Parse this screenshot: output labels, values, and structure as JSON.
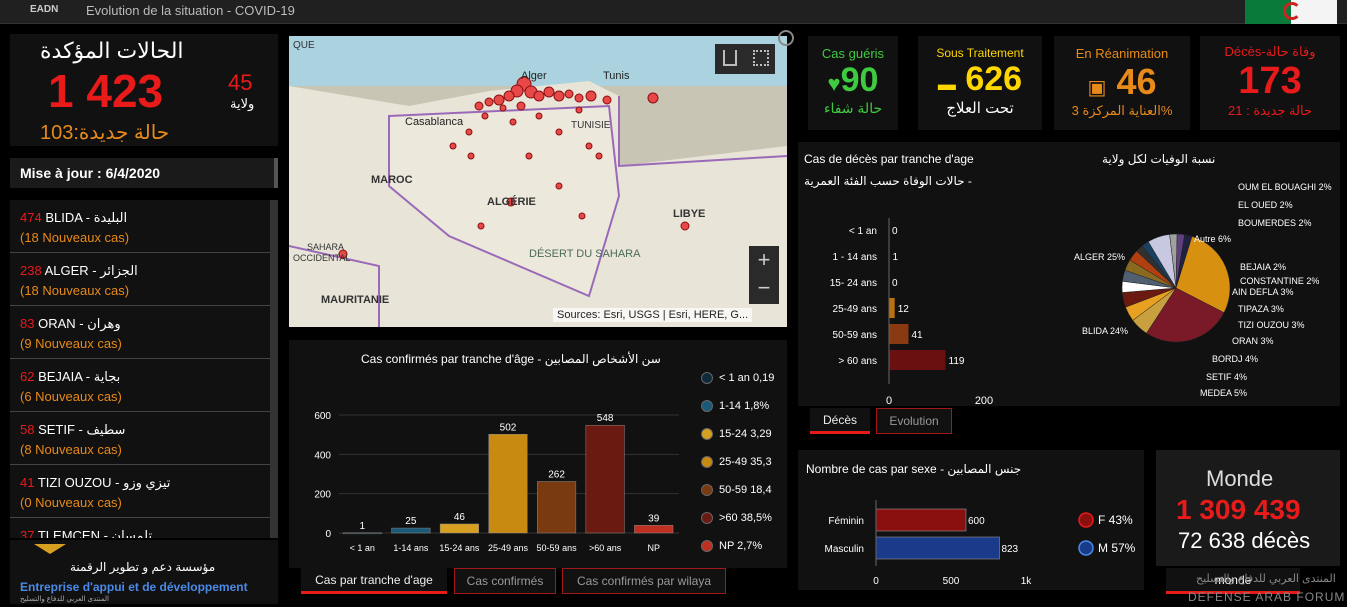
{
  "header": {
    "logo": "EADN",
    "title": "Evolution de la situation - COVID-19"
  },
  "confirmed": {
    "title_ar": "الحالات المؤكدة",
    "total": "1 423",
    "wilaya_count": "45",
    "wilaya_label": "ولاية",
    "new_cases": "حالة جديدة:103"
  },
  "update": {
    "label": "Mise à jour : 6/4/2020"
  },
  "wilaya_list": [
    {
      "count": "474",
      "name": " BLIDA - ",
      "ar": "البليدة",
      "new": "(18 Nouveaux cas)"
    },
    {
      "count": "238",
      "name": " ALGER - ",
      "ar": "الجزائر",
      "new": "(18 Nouveaux cas)"
    },
    {
      "count": "83",
      "name": " ORAN - ",
      "ar": "وهران",
      "new": "(9 Nouveaux cas)"
    },
    {
      "count": "62",
      "name": " BEJAIA - ",
      "ar": "بجاية",
      "new": "(6 Nouveaux cas)"
    },
    {
      "count": "58",
      "name": " SETIF - ",
      "ar": "سطيف",
      "new": "(8 Nouveaux cas)"
    },
    {
      "count": "41",
      "name": " TIZI OUZOU - ",
      "ar": "تيزي وزو",
      "new": "(0 Nouveaux cas)"
    },
    {
      "count": "37",
      "name": " TLEMCEN - ",
      "ar": "تلمسان",
      "new": ""
    }
  ],
  "footer_logo": {
    "ar": "مؤسسة دعم و تطوير الرقمنة",
    "fr": "Entreprise d'appui et de développement",
    "small": "المنتدى العربي للدفاع والتسليح"
  },
  "map": {
    "labels": [
      "Alger",
      "Tunis",
      "Casablanca",
      "TUNISIE",
      "MAROC",
      "ALGÉRIE",
      "LIBYE",
      "DÉSERT DU SAHARA",
      "SAHARA",
      "OCCIDENTAL",
      "MAURITANIE",
      "QUE"
    ],
    "attribution": "Sources: Esri, USGS | Esri, HERE, G..."
  },
  "stats": {
    "recovered": {
      "label": "Cas guéris",
      "value": "90",
      "ar": "حالة شفاء"
    },
    "treatment": {
      "label": "Sous Traitement",
      "value": "626",
      "ar": "تحت العلاج"
    },
    "icu": {
      "label": "En Réanimation",
      "value": "46",
      "ar": "العناية المركزة 3%"
    },
    "deaths": {
      "label": "Décès-وفاة حالة",
      "value": "173",
      "new": "حالة جديدة : 21"
    }
  },
  "age_chart": {
    "title": "Cas confirmés par tranche d'âge - سن الأشخاص المصابين",
    "legend": [
      "< 1 an 0,19",
      "1-14 1,8%",
      "15-24 3,29",
      "25-49 35,3",
      "50-59 18,4",
      ">60 38,5%",
      "NP 2,7%"
    ],
    "tabs": [
      "Cas par tranche d'age",
      "Cas confirmés",
      "Cas confirmés par wilaya"
    ]
  },
  "death_chart": {
    "title": "Cas de décès par tranche d'age",
    "subtitle": "حالات الوفاة حسب الفئة العمرية -",
    "tabs": [
      "Décès",
      "Evolution"
    ]
  },
  "pie_chart": {
    "title": "نسبة الوفيات لكل ولاية",
    "labels": [
      "OUM EL BOUAGHI 2%",
      "EL OUED 2%",
      "BOUMERDES 2%",
      "Autre 6%",
      "ALGER 25%",
      "BEJAIA 2%",
      "CONSTANTINE 2%",
      "AIN DEFLA 3%",
      "TIPAZA 3%",
      "TIZI OUZOU 3%",
      "ORAN 3%",
      "BLIDA 24%",
      "BORDJ 4%",
      "SETIF 4%",
      "MEDEA 5%"
    ]
  },
  "sex_chart": {
    "title": "Nombre de cas par sexe - جنس المصابين",
    "legend": [
      "F  43%",
      "M  57%"
    ]
  },
  "world": {
    "title": "Monde",
    "cases": "1 309 439",
    "deaths": "72 638 décès",
    "tab": "monde"
  },
  "watermark": {
    "ar": "المنتدى العربي للدفاع والتسليح",
    "en": "DEFENSE ARAB FORUM"
  },
  "colors": {
    "accent": "#e81a1a",
    "orange": "#e88a1a",
    "green": "#3fcb3f",
    "yellow": "#ffd600"
  },
  "chart_data": [
    {
      "type": "bar",
      "categories": [
        "< 1 an",
        "1-14 ans",
        "15-24 ans",
        "25-49 ans",
        "50-59 ans",
        ">60 ans",
        "NP"
      ],
      "values": [
        1,
        25,
        46,
        502,
        262,
        548,
        39
      ],
      "ylim": [
        0,
        600
      ],
      "yticks": [
        0,
        200,
        400,
        600
      ],
      "colors": [
        "#102a3a",
        "#1a5a78",
        "#d8a020",
        "#c88a10",
        "#7a3a10",
        "#6a1a10",
        "#c03020"
      ]
    },
    {
      "type": "bar",
      "orientation": "horizontal",
      "categories": [
        "< 1 an",
        "1 - 14 ans",
        "15- 24 ans",
        "25-49 ans",
        "50-59 ans",
        "> 60 ans"
      ],
      "values": [
        0,
        1,
        0,
        12,
        41,
        119
      ],
      "xlim": [
        0,
        200
      ],
      "xticks": [
        0,
        200
      ],
      "colors": [
        "#555",
        "#555",
        "#555",
        "#b87010",
        "#8a3a10",
        "#6a1010"
      ]
    },
    {
      "type": "pie",
      "categories": [
        "ALGER",
        "BLIDA",
        "MEDEA",
        "SETIF",
        "BORDJ",
        "ORAN",
        "TIZI OUZOU",
        "TIPAZA",
        "AIN DEFLA",
        "CONSTANTINE",
        "BEJAIA",
        "Autre",
        "BOUMERDES",
        "EL OUED",
        "OUM EL BOUAGHI"
      ],
      "values": [
        25,
        24,
        5,
        4,
        4,
        3,
        3,
        3,
        3,
        2,
        2,
        6,
        2,
        2,
        2
      ],
      "colors": [
        "#d89010",
        "#7a1a28",
        "#c8a040",
        "#e8a020",
        "#6a1a10",
        "#ffffff",
        "#506070",
        "#8a6a20",
        "#b04010",
        "#303030",
        "#1a4060",
        "#c8c8e0",
        "#a0a0a0",
        "#604080",
        "#202040"
      ]
    },
    {
      "type": "bar",
      "orientation": "horizontal",
      "categories": [
        "Féminin",
        "Masculin"
      ],
      "values": [
        600,
        823
      ],
      "xlim": [
        0,
        1000
      ],
      "xticks": [
        0,
        500,
        1000
      ],
      "xticklabels": [
        "0",
        "500",
        "1k"
      ],
      "colors": [
        "#8a1010",
        "#1a3a8a"
      ]
    }
  ]
}
